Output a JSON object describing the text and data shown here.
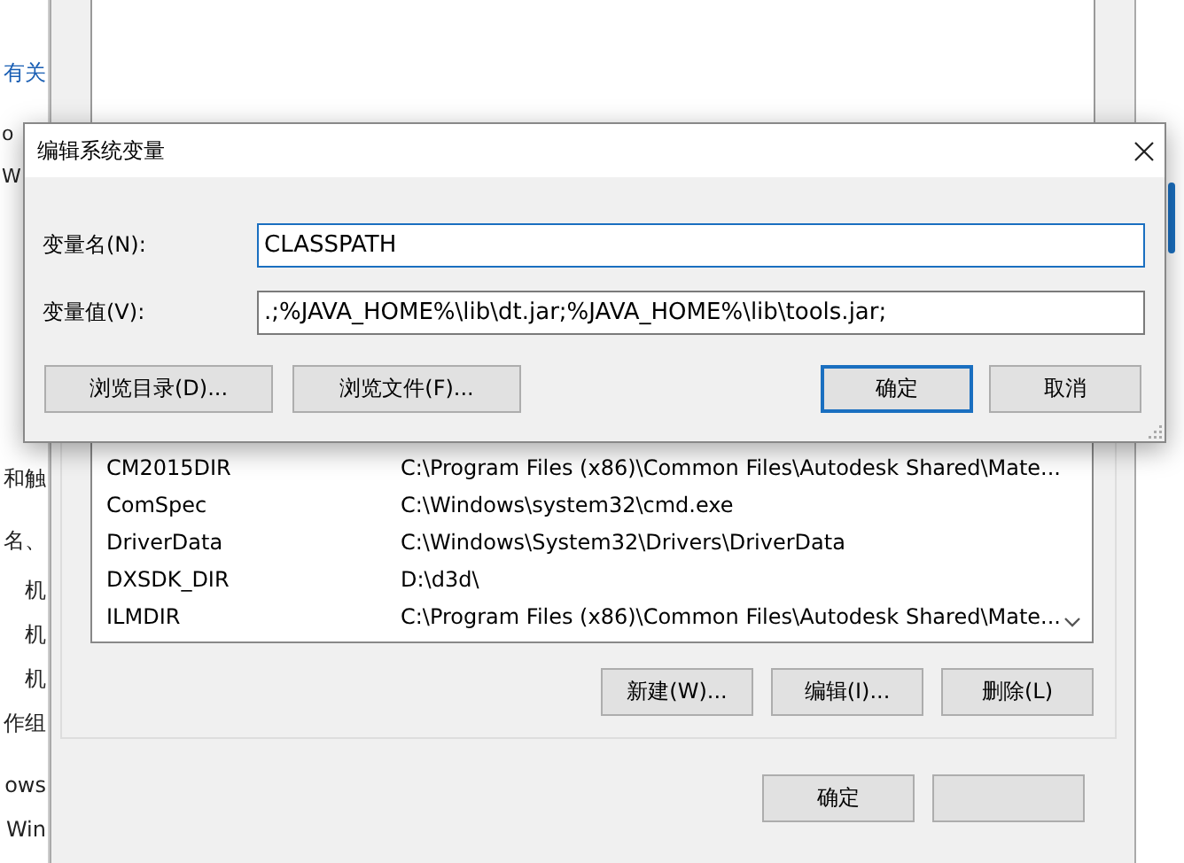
{
  "background_window": {
    "fragments": [
      {
        "text": "有关",
        "link": true
      },
      {
        "text": "o",
        "link": false
      },
      {
        "text": "W",
        "link": false
      },
      {
        "text": "和触",
        "link": false
      },
      {
        "text": "名、",
        "link": false
      },
      {
        "text": "机",
        "link": false
      },
      {
        "text": "机",
        "link": false
      },
      {
        "text": "机",
        "link": false
      },
      {
        "text": "作组",
        "link": false
      },
      {
        "text": "ows",
        "link": false
      },
      {
        "text": "Win",
        "link": false
      }
    ]
  },
  "env_window": {
    "system_variables": [
      {
        "name": "CM2015DIR",
        "value": "C:\\Program Files (x86)\\Common Files\\Autodesk Shared\\Mate..."
      },
      {
        "name": "ComSpec",
        "value": "C:\\Windows\\system32\\cmd.exe"
      },
      {
        "name": "DriverData",
        "value": "C:\\Windows\\System32\\Drivers\\DriverData"
      },
      {
        "name": "DXSDK_DIR",
        "value": "D:\\d3d\\"
      },
      {
        "name": "ILMDIR",
        "value": "C:\\Program Files (x86)\\Common Files\\Autodesk Shared\\Mate..."
      }
    ],
    "list_buttons": [
      "新建(W)...",
      "编辑(I)...",
      "删除(L)"
    ],
    "footer_buttons": [
      {
        "kind": "labeled",
        "label": "确定"
      },
      {
        "kind": "covered"
      }
    ]
  },
  "dialog": {
    "title": "编辑系统变量",
    "fields": [
      {
        "label": "变量名(N):",
        "value": "CLASSPATH",
        "focused": true
      },
      {
        "label": "变量值(V):",
        "value": ".;%JAVA_HOME%\\lib\\dt.jar;%JAVA_HOME%\\lib\\tools.jar;",
        "focused": false
      }
    ],
    "left_buttons": [
      "浏览目录(D)...",
      "浏览文件(F)..."
    ],
    "right_buttons": [
      {
        "label": "确定",
        "default": true
      },
      {
        "label": "取消",
        "default": false
      }
    ]
  }
}
